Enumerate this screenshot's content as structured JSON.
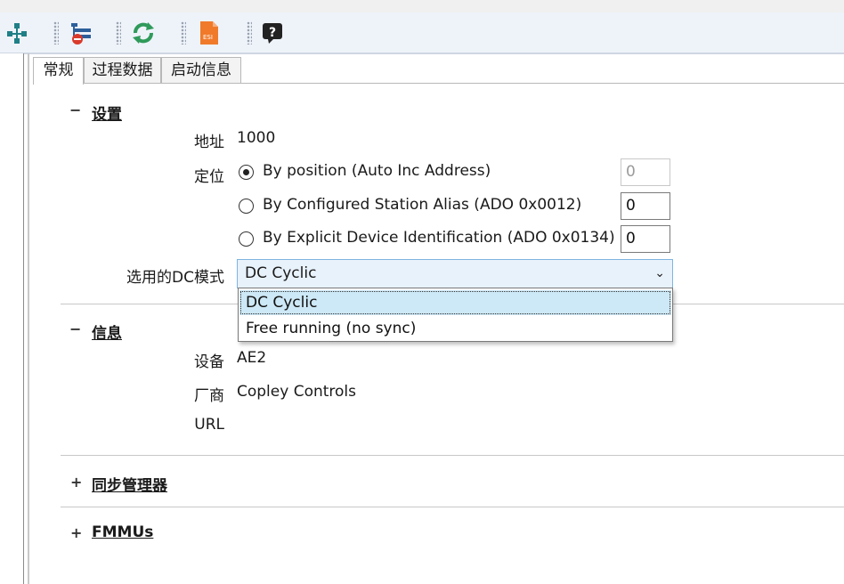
{
  "tabs": [
    "常规",
    "过程数据",
    "启动信息"
  ],
  "settings": {
    "toggle": "−",
    "title": "设置",
    "address_label": "地址",
    "address_value": "1000",
    "position_label": "定位",
    "options": [
      {
        "label": "By position (Auto Inc Address)",
        "value": "0",
        "selected": true,
        "disabled": true
      },
      {
        "label": "By Configured Station Alias (ADO 0x0012)",
        "value": "0",
        "selected": false,
        "disabled": false
      },
      {
        "label": "By Explicit Device Identification (ADO 0x0134)",
        "value": "0",
        "selected": false,
        "disabled": false
      }
    ],
    "dc_label": "选用的DC模式",
    "dc_value": "DC Cyclic",
    "dc_options": [
      "DC Cyclic",
      "Free running (no sync)"
    ]
  },
  "info": {
    "toggle": "−",
    "title": "信息",
    "device_label": "设备",
    "device_value": "AE2",
    "vendor_label": "厂商",
    "vendor_value": "Copley Controls",
    "url_label": "URL",
    "url_value": ""
  },
  "sync": {
    "toggle": "+",
    "title": "同步管理器"
  },
  "fmmu": {
    "toggle": "+",
    "title": "FMMUs"
  },
  "toolbar": {
    "esi_text": "ESI",
    "help_text": "?",
    "icons": [
      "network-tree-icon",
      "remove-device-icon",
      "refresh-icon",
      "esi-file-icon",
      "help-icon"
    ]
  }
}
